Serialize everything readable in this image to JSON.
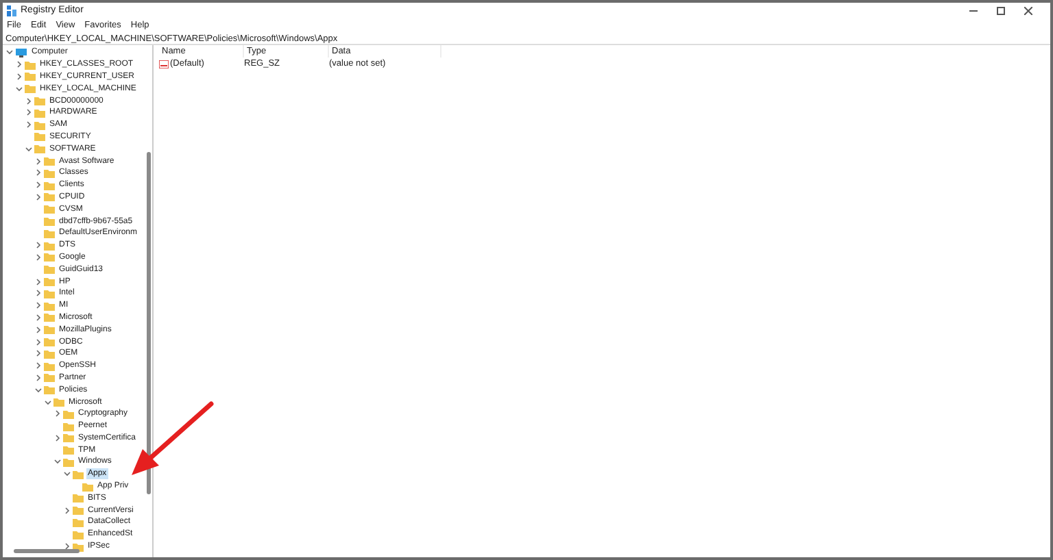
{
  "window": {
    "title": "Registry Editor"
  },
  "menu": [
    "File",
    "Edit",
    "View",
    "Favorites",
    "Help"
  ],
  "address": "Computer\\HKEY_LOCAL_MACHINE\\SOFTWARE\\Policies\\Microsoft\\Windows\\Appx",
  "tree": [
    {
      "label": "Computer",
      "kind": "computer",
      "expanded": true,
      "selected": false,
      "children": [
        {
          "label": "HKEY_CLASSES_ROOT",
          "kind": "folder",
          "expanded": false,
          "selected": false
        },
        {
          "label": "HKEY_CURRENT_USER",
          "kind": "folder",
          "expanded": false,
          "selected": false
        },
        {
          "label": "HKEY_LOCAL_MACHINE",
          "kind": "folder",
          "expanded": true,
          "selected": false,
          "children": [
            {
              "label": "BCD00000000",
              "kind": "folder",
              "expanded": false,
              "selected": false
            },
            {
              "label": "HARDWARE",
              "kind": "folder",
              "expanded": false,
              "selected": false
            },
            {
              "label": "SAM",
              "kind": "folder",
              "expanded": false,
              "selected": false
            },
            {
              "label": "SECURITY",
              "kind": "folder",
              "selected": false
            },
            {
              "label": "SOFTWARE",
              "kind": "folder",
              "expanded": true,
              "selected": false,
              "children": [
                {
                  "label": "Avast Software",
                  "kind": "folder",
                  "expanded": false,
                  "selected": false
                },
                {
                  "label": "Classes",
                  "kind": "folder",
                  "expanded": false,
                  "selected": false
                },
                {
                  "label": "Clients",
                  "kind": "folder",
                  "expanded": false,
                  "selected": false
                },
                {
                  "label": "CPUID",
                  "kind": "folder",
                  "expanded": false,
                  "selected": false
                },
                {
                  "label": "CVSM",
                  "kind": "folder",
                  "selected": false
                },
                {
                  "label": "dbd7cffb-9b67-55a5",
                  "kind": "folder",
                  "selected": false
                },
                {
                  "label": "DefaultUserEnvironm",
                  "kind": "folder",
                  "selected": false
                },
                {
                  "label": "DTS",
                  "kind": "folder",
                  "expanded": false,
                  "selected": false
                },
                {
                  "label": "Google",
                  "kind": "folder",
                  "expanded": false,
                  "selected": false
                },
                {
                  "label": "GuidGuid13",
                  "kind": "folder",
                  "selected": false
                },
                {
                  "label": "HP",
                  "kind": "folder",
                  "expanded": false,
                  "selected": false
                },
                {
                  "label": "Intel",
                  "kind": "folder",
                  "expanded": false,
                  "selected": false
                },
                {
                  "label": "MI",
                  "kind": "folder",
                  "expanded": false,
                  "selected": false
                },
                {
                  "label": "Microsoft",
                  "kind": "folder",
                  "expanded": false,
                  "selected": false
                },
                {
                  "label": "MozillaPlugins",
                  "kind": "folder",
                  "expanded": false,
                  "selected": false
                },
                {
                  "label": "ODBC",
                  "kind": "folder",
                  "expanded": false,
                  "selected": false
                },
                {
                  "label": "OEM",
                  "kind": "folder",
                  "expanded": false,
                  "selected": false
                },
                {
                  "label": "OpenSSH",
                  "kind": "folder",
                  "expanded": false,
                  "selected": false
                },
                {
                  "label": "Partner",
                  "kind": "folder",
                  "expanded": false,
                  "selected": false
                },
                {
                  "label": "Policies",
                  "kind": "folder",
                  "expanded": true,
                  "selected": false,
                  "children": [
                    {
                      "label": "Microsoft",
                      "kind": "folder",
                      "expanded": true,
                      "selected": false,
                      "children": [
                        {
                          "label": "Cryptography",
                          "kind": "folder",
                          "expanded": false,
                          "selected": false
                        },
                        {
                          "label": "Peernet",
                          "kind": "folder",
                          "selected": false
                        },
                        {
                          "label": "SystemCertifica",
                          "kind": "folder",
                          "expanded": false,
                          "selected": false
                        },
                        {
                          "label": "TPM",
                          "kind": "folder",
                          "selected": false
                        },
                        {
                          "label": "Windows",
                          "kind": "folder",
                          "expanded": true,
                          "selected": false,
                          "children": [
                            {
                              "label": "Appx",
                              "kind": "folder",
                              "expanded": true,
                              "selected": true,
                              "children": [
                                {
                                  "label": "App Priv",
                                  "kind": "folder",
                                  "selected": false
                                }
                              ]
                            },
                            {
                              "label": "BITS",
                              "kind": "folder",
                              "selected": false
                            },
                            {
                              "label": "CurrentVersi",
                              "kind": "folder",
                              "expanded": false,
                              "selected": false
                            },
                            {
                              "label": "DataCollect",
                              "kind": "folder",
                              "selected": false
                            },
                            {
                              "label": "EnhancedSt",
                              "kind": "folder",
                              "selected": false
                            },
                            {
                              "label": "IPSec",
                              "kind": "folder",
                              "expanded": false,
                              "selected": false
                            }
                          ]
                        }
                      ]
                    }
                  ]
                }
              ]
            }
          ]
        }
      ]
    }
  ],
  "columns": [
    "Name",
    "Type",
    "Data"
  ],
  "values": [
    {
      "name": "(Default)",
      "type": "REG_SZ",
      "data": "(value not set)"
    }
  ]
}
